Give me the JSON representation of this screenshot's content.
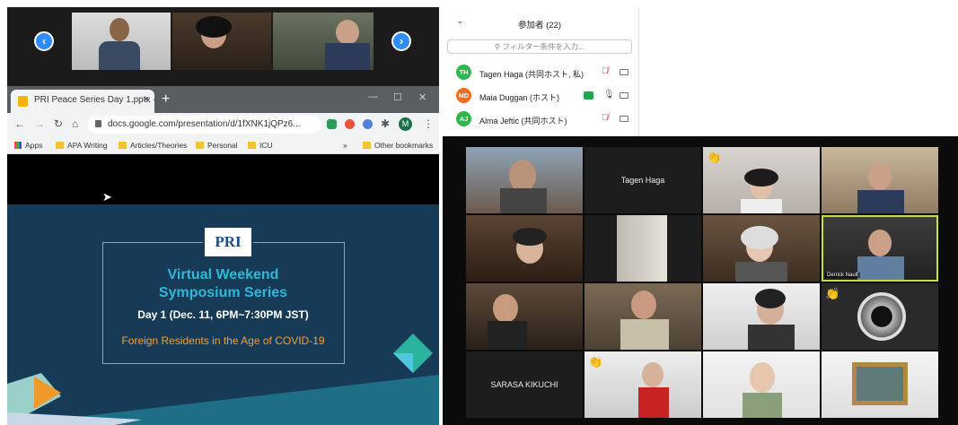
{
  "filmstrip": {
    "prev_icon": "‹",
    "next_icon": "›"
  },
  "browser": {
    "tab_title": "PRI Peace Series Day 1.pptx - Go",
    "tab_close": "×",
    "new_tab": "+",
    "url": "docs.google.com/presentation/d/1fXNK1jQPz6...",
    "profile_initial": "M",
    "bookmarks": [
      "Apps",
      "APA Writing",
      "Articles/Theories",
      "Personal",
      "ICU"
    ],
    "bookmarks_more": "»",
    "other_bookmarks": "Other bookmarks"
  },
  "slide": {
    "title_line1": "Virtual Weekend",
    "title_line2": "Symposium Series",
    "day": "Day 1 (Dec. 11, 6PM~7:30PM JST)",
    "subtitle": "Foreign Residents in the Age of COVID-19",
    "logo_text": "PRI"
  },
  "participants": {
    "header": "参加者 (22)",
    "search_placeholder": "フィルター条件を入力...",
    "list": [
      {
        "initials": "TH",
        "name": "Tagen Haga (共同ホスト, 私)",
        "color": "#2db84d",
        "mic": "muted"
      },
      {
        "initials": "MD",
        "name": "Maia Duggan (ホスト)",
        "color": "#f26b1d",
        "mic": "on"
      },
      {
        "initials": "AJ",
        "name": "Alma Jeftic (共同ホスト)",
        "color": "#2db84d",
        "mic": "muted"
      }
    ]
  },
  "gallery": {
    "name_tiles": [
      "Tagen Haga",
      "SARASA KIKUCHI"
    ],
    "speaker_label": "Derrick Nault"
  },
  "colors": {
    "zoom_blue": "#2d8cff",
    "slide_bg": "#173a57",
    "slide_title": "#2fb8d8",
    "slide_sub": "#f2a03d",
    "active_speaker": "#c6e03a"
  }
}
